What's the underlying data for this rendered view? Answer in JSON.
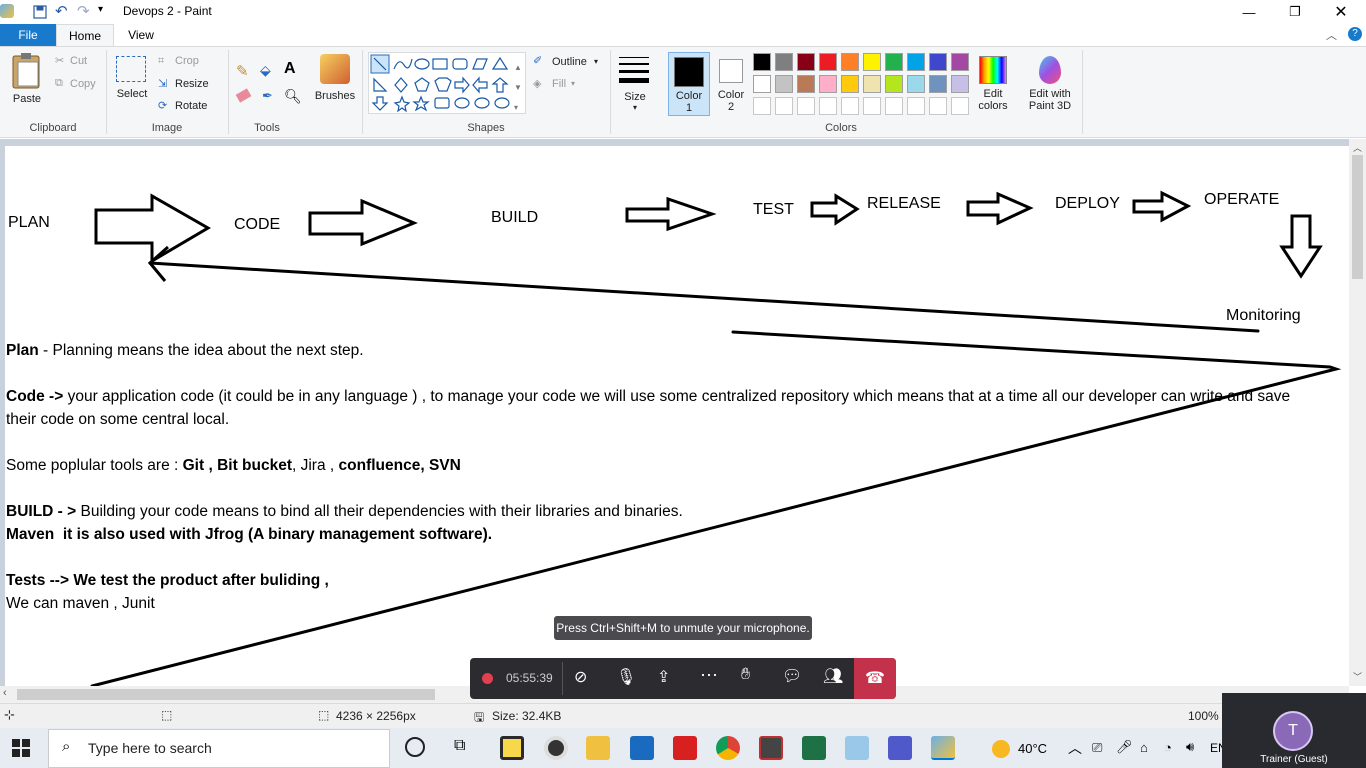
{
  "window": {
    "title": "Devops 2 - Paint"
  },
  "tabs": [
    {
      "label": "File"
    },
    {
      "label": "Home"
    },
    {
      "label": "View"
    }
  ],
  "clipboard": {
    "paste": "Paste",
    "cut": "Cut",
    "copy": "Copy",
    "group": "Clipboard"
  },
  "image": {
    "select": "Select",
    "crop": "Crop",
    "resize": "Resize",
    "rotate": "Rotate",
    "group": "Image"
  },
  "tools": {
    "group": "Tools"
  },
  "brushes": {
    "label": "Brushes"
  },
  "shapes": {
    "outline": "Outline",
    "fill": "Fill",
    "group": "Shapes"
  },
  "size": {
    "label": "Size"
  },
  "colors": {
    "color1": "Color\n1",
    "color2": "Color\n2",
    "edit": "Edit\ncolors",
    "paint3d": "Edit with\nPaint 3D",
    "group": "Colors",
    "row1": [
      "#000000",
      "#7f7f7f",
      "#880015",
      "#ed1c24",
      "#ff7f27",
      "#fff200",
      "#22b14c",
      "#00a2e8",
      "#3f48cc",
      "#a349a4"
    ],
    "row2": [
      "#ffffff",
      "#c3c3c3",
      "#b97a57",
      "#ffaec9",
      "#ffc90e",
      "#efe4b0",
      "#b5e61d",
      "#99d9ea",
      "#7092be",
      "#c8bfe7"
    ]
  },
  "diagram": {
    "plan": "PLAN",
    "code": "CODE",
    "build": "BUILD",
    "test": "TEST",
    "release": "RELEASE",
    "deploy": "DEPLOY",
    "operate": "OPERATE",
    "monitoring": "Monitoring"
  },
  "notes": {
    "plan_b": "Plan",
    "plan_t": " - Planning means the idea about the next step.",
    "code_b": "Code ->",
    "code_t": " your application code (it could be in any language ) , to manage your code we will use some centralized repository which means that at a time all our developer can write and save their code on some central local.",
    "tools_pre": "Some poplular tools are : ",
    "tools_b1": "Git , Bit bucket",
    "tools_mid": ", Jira , ",
    "tools_b2": "confluence, SVN",
    "build_b": "BUILD - >",
    "build_t": " Building your code means to bind all their dependencies with their libraries and binaries.",
    "maven": "Maven  it is also used with Jfrog (A binary management software).",
    "tests": "Tests --> We test the product after buliding ,",
    "tests2": "We can maven , Junit"
  },
  "status": {
    "dims": "4236 × 2256px",
    "size": "Size: 32.4KB",
    "zoom": "100%"
  },
  "meeting": {
    "time": "05:55:39",
    "tooltip": "Press Ctrl+Shift+M to unmute your microphone.",
    "guest": "Trainer (Guest)",
    "avatar": "T"
  },
  "taskbar": {
    "search": "Type here to search",
    "temp": "40°C",
    "lang": "EN"
  }
}
